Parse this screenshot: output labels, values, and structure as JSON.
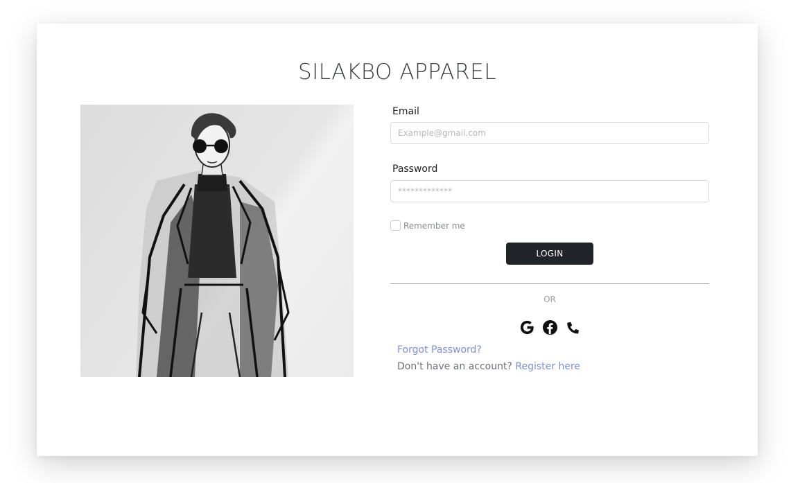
{
  "brand": {
    "title": "SILAKBO APPAREL"
  },
  "illustration": {
    "icon": "fashion-sketch-man-sunglasses"
  },
  "form": {
    "email_label": "Email",
    "email_placeholder": "Example@gmail.com",
    "password_label": "Password",
    "password_placeholder": "*************",
    "remember_label": "Remember me",
    "remember_checked": false,
    "login_label": "LOGIN"
  },
  "divider": {
    "or_text": "OR"
  },
  "social": [
    {
      "icon": "google-icon"
    },
    {
      "icon": "facebook-icon"
    },
    {
      "icon": "phone-icon"
    }
  ],
  "links": {
    "forgot_password": "Forgot Password?",
    "no_account_text": "Don't have an account?",
    "register_link": "Register here"
  },
  "colors": {
    "button_bg": "#212529",
    "link": "#7b8fd8",
    "title": "#3a3d45"
  }
}
